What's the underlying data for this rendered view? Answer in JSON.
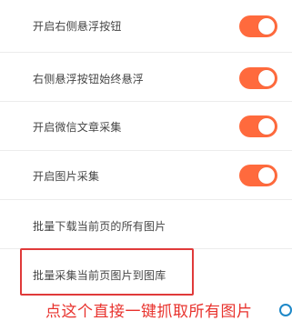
{
  "settings": {
    "items": [
      {
        "label": "开启右侧悬浮按钮",
        "toggle": true,
        "enabled": true
      },
      {
        "label": "右侧悬浮按钮始终悬浮",
        "toggle": true,
        "enabled": true
      },
      {
        "label": "开启微信文章采集",
        "toggle": true,
        "enabled": true
      },
      {
        "label": "开启图片采集",
        "toggle": true,
        "enabled": true
      },
      {
        "label": "批量下载当前页的所有图片",
        "toggle": false
      },
      {
        "label": "批量采集当前页图片到图库",
        "toggle": false
      }
    ]
  },
  "annotation": {
    "text": "点这个直接一键抓取所有图片"
  },
  "colors": {
    "toggle_on": "#ff6a3d",
    "highlight_border": "#e03a3a",
    "annotation_text": "#e8322d"
  }
}
